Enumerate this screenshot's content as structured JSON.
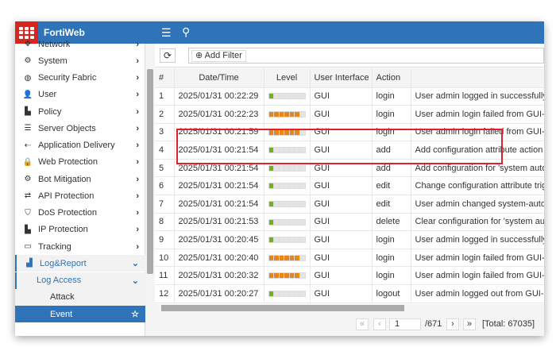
{
  "app": {
    "title": "FortiWeb"
  },
  "sidebar": {
    "items": [
      {
        "label": "Network",
        "icon": "network-icon",
        "glyph": "✥",
        "chev": "›"
      },
      {
        "label": "System",
        "icon": "gear-icon",
        "glyph": "⚙",
        "chev": "›"
      },
      {
        "label": "Security Fabric",
        "icon": "fabric-icon",
        "glyph": "◍",
        "chev": "›"
      },
      {
        "label": "User",
        "icon": "user-icon",
        "glyph": "👤",
        "chev": "›"
      },
      {
        "label": "Policy",
        "icon": "policy-icon",
        "glyph": "▙",
        "chev": "›"
      },
      {
        "label": "Server Objects",
        "icon": "server-icon",
        "glyph": "☰",
        "chev": "›"
      },
      {
        "label": "Application Delivery",
        "icon": "delivery-icon",
        "glyph": "⇠",
        "chev": "›"
      },
      {
        "label": "Web Protection",
        "icon": "lock-icon",
        "glyph": "🔒",
        "chev": "›"
      },
      {
        "label": "Bot Mitigation",
        "icon": "cogs-icon",
        "glyph": "⚙",
        "chev": "›"
      },
      {
        "label": "API Protection",
        "icon": "exchange-icon",
        "glyph": "⇄",
        "chev": "›"
      },
      {
        "label": "DoS Protection",
        "icon": "shield-icon",
        "glyph": "⛉",
        "chev": "›"
      },
      {
        "label": "IP Protection",
        "icon": "ip-icon",
        "glyph": "▙",
        "chev": "›"
      },
      {
        "label": "Tracking",
        "icon": "laptop-icon",
        "glyph": "▭",
        "chev": "›"
      },
      {
        "label": "Log&Report",
        "icon": "chart-icon",
        "glyph": "▟",
        "chev": "⌄"
      },
      {
        "label": "Log Access",
        "chev": "⌄"
      },
      {
        "label": "Attack"
      },
      {
        "label": "Event",
        "star": "☆"
      }
    ]
  },
  "toolbar": {
    "add_filter": "Add Filter"
  },
  "table": {
    "columns": [
      "#",
      "Date/Time",
      "Level",
      "User Interface",
      "Action",
      ""
    ],
    "rows": [
      {
        "n": "1",
        "dt": "2025/01/31 00:22:29",
        "level": "information",
        "ui": "GUI",
        "action": "login",
        "msg": "User admin logged in successfully fr"
      },
      {
        "n": "2",
        "dt": "2025/01/31 00:22:23",
        "level": "alert",
        "ui": "GUI",
        "action": "login",
        "msg": "User admin login failed from GUI->"
      },
      {
        "n": "3",
        "dt": "2025/01/31 00:21:59",
        "level": "alert",
        "ui": "GUI",
        "action": "login",
        "msg": "User admin login failed from GUI->"
      },
      {
        "n": "4",
        "dt": "2025/01/31 00:21:54",
        "level": "information",
        "ui": "GUI",
        "action": "add",
        "msg": "Add configuration attribute action"
      },
      {
        "n": "5",
        "dt": "2025/01/31 00:21:54",
        "level": "information",
        "ui": "GUI",
        "action": "add",
        "msg": "Add configuration for 'system auto"
      },
      {
        "n": "6",
        "dt": "2025/01/31 00:21:54",
        "level": "information",
        "ui": "GUI",
        "action": "edit",
        "msg": "Change configuration attribute trig"
      },
      {
        "n": "7",
        "dt": "2025/01/31 00:21:54",
        "level": "information",
        "ui": "GUI",
        "action": "edit",
        "msg": "User admin changed system-autom"
      },
      {
        "n": "8",
        "dt": "2025/01/31 00:21:53",
        "level": "information",
        "ui": "GUI",
        "action": "delete",
        "msg": "Clear configuration for 'system aut"
      },
      {
        "n": "9",
        "dt": "2025/01/31 00:20:45",
        "level": "information",
        "ui": "GUI",
        "action": "login",
        "msg": "User admin logged in successfully fr"
      },
      {
        "n": "10",
        "dt": "2025/01/31 00:20:40",
        "level": "alert",
        "ui": "GUI",
        "action": "login",
        "msg": "User admin login failed from GUI->"
      },
      {
        "n": "11",
        "dt": "2025/01/31 00:20:32",
        "level": "alert",
        "ui": "GUI",
        "action": "login",
        "msg": "User admin login failed from GUI->"
      },
      {
        "n": "12",
        "dt": "2025/01/31 00:20:27",
        "level": "information",
        "ui": "GUI",
        "action": "logout",
        "msg": "User admin logged out from GUI->"
      }
    ]
  },
  "levels": {
    "information": {
      "filled": 1,
      "color": "#6cb31c"
    },
    "alert": {
      "filled": 6,
      "color": "#e8841a"
    }
  },
  "pager": {
    "first": "«",
    "prev": "‹",
    "page": "1",
    "of": "/671",
    "next": "›",
    "last": "»",
    "total": "[Total: 67035]"
  }
}
